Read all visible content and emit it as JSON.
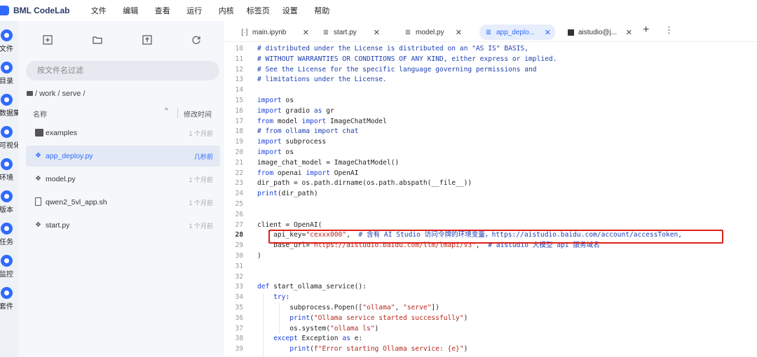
{
  "app": {
    "title": "BML CodeLab"
  },
  "menus": [
    "文件",
    "编辑",
    "查看",
    "运行",
    "内核",
    "标签页",
    "设置",
    "帮助"
  ],
  "activity_bar": [
    {
      "label": "文件",
      "icon": "folder-icon"
    },
    {
      "label": "目录",
      "icon": "toc-icon"
    },
    {
      "label": "数据集",
      "icon": "dataset-icon"
    },
    {
      "label": "可视化",
      "icon": "visualization-icon"
    },
    {
      "label": "环境",
      "icon": "environment-icon"
    },
    {
      "label": "版本",
      "icon": "version-icon"
    },
    {
      "label": "任务",
      "icon": "task-icon"
    },
    {
      "label": "监控",
      "icon": "monitor-icon"
    },
    {
      "label": "套件",
      "icon": "suite-icon"
    }
  ],
  "explorer": {
    "filter_placeholder": "按文件名过滤",
    "path": "/ work / serve /",
    "col_name": "名称",
    "col_mtime": "修改时间",
    "files": [
      {
        "name": "examples",
        "time": "1 个月前",
        "type": "folder"
      },
      {
        "name": "app_deploy.py",
        "time": "几秒前",
        "type": "py",
        "selected": true
      },
      {
        "name": "model.py",
        "time": "1 个月前",
        "type": "py"
      },
      {
        "name": "qwen2_5vl_app.sh",
        "time": "1 个月前",
        "type": "file"
      },
      {
        "name": "start.py",
        "time": "1 个月前",
        "type": "py"
      }
    ]
  },
  "tabs": [
    {
      "label": "main.ipynb",
      "icon": "notebook-icon",
      "active": false
    },
    {
      "label": "start.py",
      "icon": "text-file-icon",
      "active": false
    },
    {
      "label": "model.py",
      "icon": "text-file-icon",
      "active": false
    },
    {
      "label": "app_deplo...",
      "icon": "text-file-icon",
      "active": true
    },
    {
      "label": "aistudio@j...",
      "icon": "terminal-icon",
      "active": false
    }
  ],
  "editor": {
    "current_line": 28,
    "lines": [
      {
        "n": "10",
        "tokens": [
          [
            "cm",
            "# distributed under the License is distributed on an \"AS IS\" BASIS,"
          ]
        ]
      },
      {
        "n": "11",
        "tokens": [
          [
            "cm",
            "# WITHOUT WARRANTIES OR CONDITIONS OF ANY KIND, either express or implied."
          ]
        ]
      },
      {
        "n": "12",
        "tokens": [
          [
            "cm",
            "# See the License for the specific language governing permissions and"
          ]
        ]
      },
      {
        "n": "13",
        "tokens": [
          [
            "cm",
            "# limitations under the License."
          ]
        ]
      },
      {
        "n": "14",
        "tokens": []
      },
      {
        "n": "15",
        "tokens": [
          [
            "kw",
            "import"
          ],
          [
            "",
            " os"
          ]
        ]
      },
      {
        "n": "16",
        "tokens": [
          [
            "kw",
            "import"
          ],
          [
            "",
            " gradio "
          ],
          [
            "kw",
            "as"
          ],
          [
            "",
            " gr"
          ]
        ]
      },
      {
        "n": "17",
        "tokens": [
          [
            "kw",
            "from"
          ],
          [
            "",
            " model "
          ],
          [
            "kw",
            "import"
          ],
          [
            "",
            " ImageChatModel"
          ]
        ]
      },
      {
        "n": "18",
        "tokens": [
          [
            "cm",
            "# from ollama import chat"
          ]
        ]
      },
      {
        "n": "19",
        "tokens": [
          [
            "kw",
            "import"
          ],
          [
            "",
            " subprocess"
          ]
        ]
      },
      {
        "n": "20",
        "tokens": [
          [
            "kw",
            "import"
          ],
          [
            "",
            " os"
          ]
        ]
      },
      {
        "n": "21",
        "tokens": [
          [
            "",
            "image_chat_model = ImageChatModel()"
          ]
        ]
      },
      {
        "n": "22",
        "tokens": [
          [
            "kw",
            "from"
          ],
          [
            "",
            " openai "
          ],
          [
            "kw",
            "import"
          ],
          [
            "",
            " OpenAI"
          ]
        ]
      },
      {
        "n": "23",
        "tokens": [
          [
            "",
            "dir_path = os.path.dirname(os.path.abspath(__file__))"
          ]
        ]
      },
      {
        "n": "24",
        "tokens": [
          [
            "fn",
            "print"
          ],
          [
            "",
            "(dir_path)"
          ]
        ]
      },
      {
        "n": "25",
        "tokens": []
      },
      {
        "n": "26",
        "tokens": []
      },
      {
        "n": "27",
        "tokens": [
          [
            "",
            "client = OpenAI("
          ]
        ]
      },
      {
        "n": "28",
        "tokens": [
          [
            "",
            "    api_key="
          ],
          [
            "str",
            "\"cexxx000\""
          ],
          [
            "",
            ",  "
          ],
          [
            "cm",
            "# 含有 AI Studio 访问令牌的环境变量，https://aistudio.baidu.com/account/accessToken,"
          ]
        ]
      },
      {
        "n": "29",
        "tokens": [
          [
            "",
            "    base_url="
          ],
          [
            "str",
            "\"https://aistudio.baidu.com/llm/lmapi/v3\""
          ],
          [
            "",
            ",  "
          ],
          [
            "cm",
            "# aistudio 大模型 api 服务域名"
          ]
        ]
      },
      {
        "n": "30",
        "tokens": [
          [
            "",
            ")"
          ]
        ]
      },
      {
        "n": "31",
        "tokens": []
      },
      {
        "n": "32",
        "tokens": []
      },
      {
        "n": "33",
        "tokens": [
          [
            "kw",
            "def"
          ],
          [
            "",
            " start_ollama_service():"
          ]
        ]
      },
      {
        "n": "34",
        "tokens": [
          [
            "",
            "    "
          ],
          [
            "kw",
            "try"
          ],
          [
            "",
            ":"
          ]
        ]
      },
      {
        "n": "35",
        "tokens": [
          [
            "",
            "        subprocess.Popen(["
          ],
          [
            "str",
            "\"ollama\""
          ],
          [
            "",
            ", "
          ],
          [
            "str",
            "\"serve\""
          ],
          [
            "",
            "])"
          ]
        ]
      },
      {
        "n": "36",
        "tokens": [
          [
            "",
            "        "
          ],
          [
            "fn",
            "print"
          ],
          [
            "",
            "("
          ],
          [
            "str",
            "\"Ollama service started successfully\""
          ],
          [
            "",
            ")"
          ]
        ]
      },
      {
        "n": "37",
        "tokens": [
          [
            "",
            "        os.system("
          ],
          [
            "str",
            "\"ollama ls\""
          ],
          [
            "",
            ")"
          ]
        ]
      },
      {
        "n": "38",
        "tokens": [
          [
            "",
            "    "
          ],
          [
            "kw",
            "except"
          ],
          [
            "",
            " Exception "
          ],
          [
            "kw",
            "as"
          ],
          [
            "",
            " e:"
          ]
        ]
      },
      {
        "n": "39",
        "tokens": [
          [
            "",
            "        "
          ],
          [
            "fn",
            "print"
          ],
          [
            "",
            "("
          ],
          [
            "str",
            "f\"Error starting Ollama service: {e}\""
          ],
          [
            "",
            ")"
          ]
        ]
      }
    ]
  },
  "colors": {
    "accent": "#2f6bff",
    "highlight_box": "#e0201b"
  }
}
